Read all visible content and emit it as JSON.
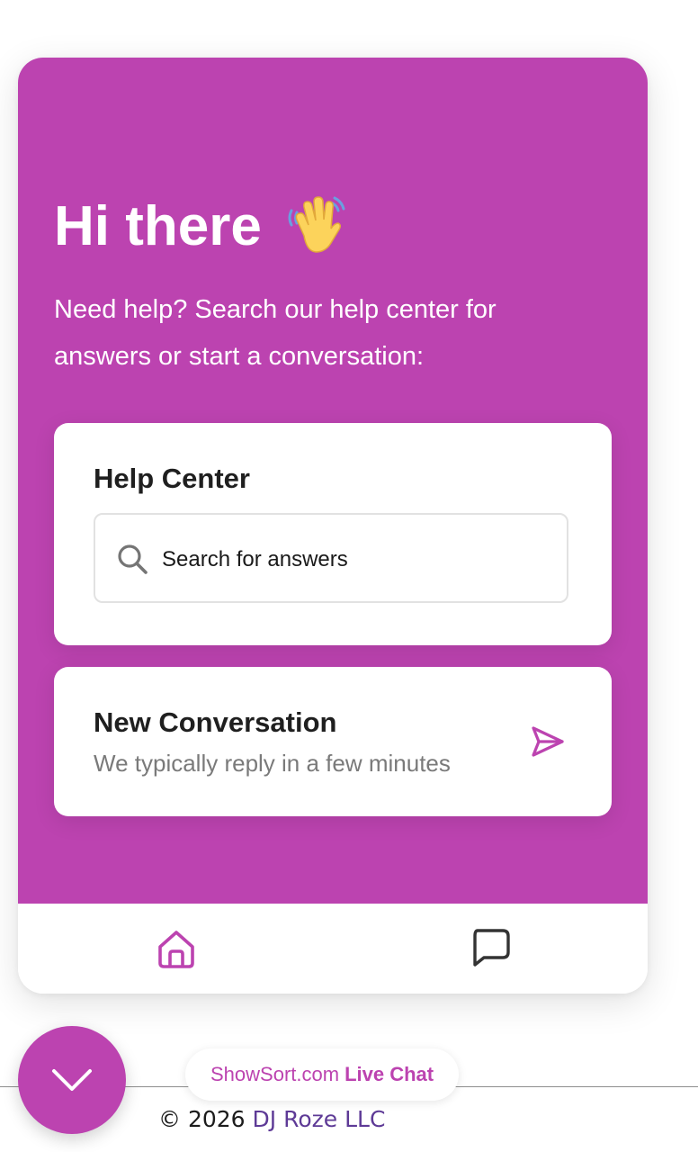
{
  "widget": {
    "greeting": "Hi there",
    "intro": "Need help? Search our help center for answers or start a conversation:",
    "help_center": {
      "title": "Help Center",
      "search_placeholder": "Search for answers"
    },
    "new_conversation": {
      "title": "New Conversation",
      "subtitle": "We typically reply in a few minutes"
    },
    "nav": {
      "home_icon": "home-icon",
      "messages_icon": "chat-bubble-icon"
    }
  },
  "launcher": {
    "icon": "chevron-down-icon"
  },
  "branding": {
    "site": "ShowSort.com",
    "label": "Live Chat"
  },
  "footer": {
    "copyright": "© 2026",
    "company": "DJ Roze LLC"
  },
  "colors": {
    "accent": "#bc43b0",
    "company_link": "#5e3a96"
  }
}
